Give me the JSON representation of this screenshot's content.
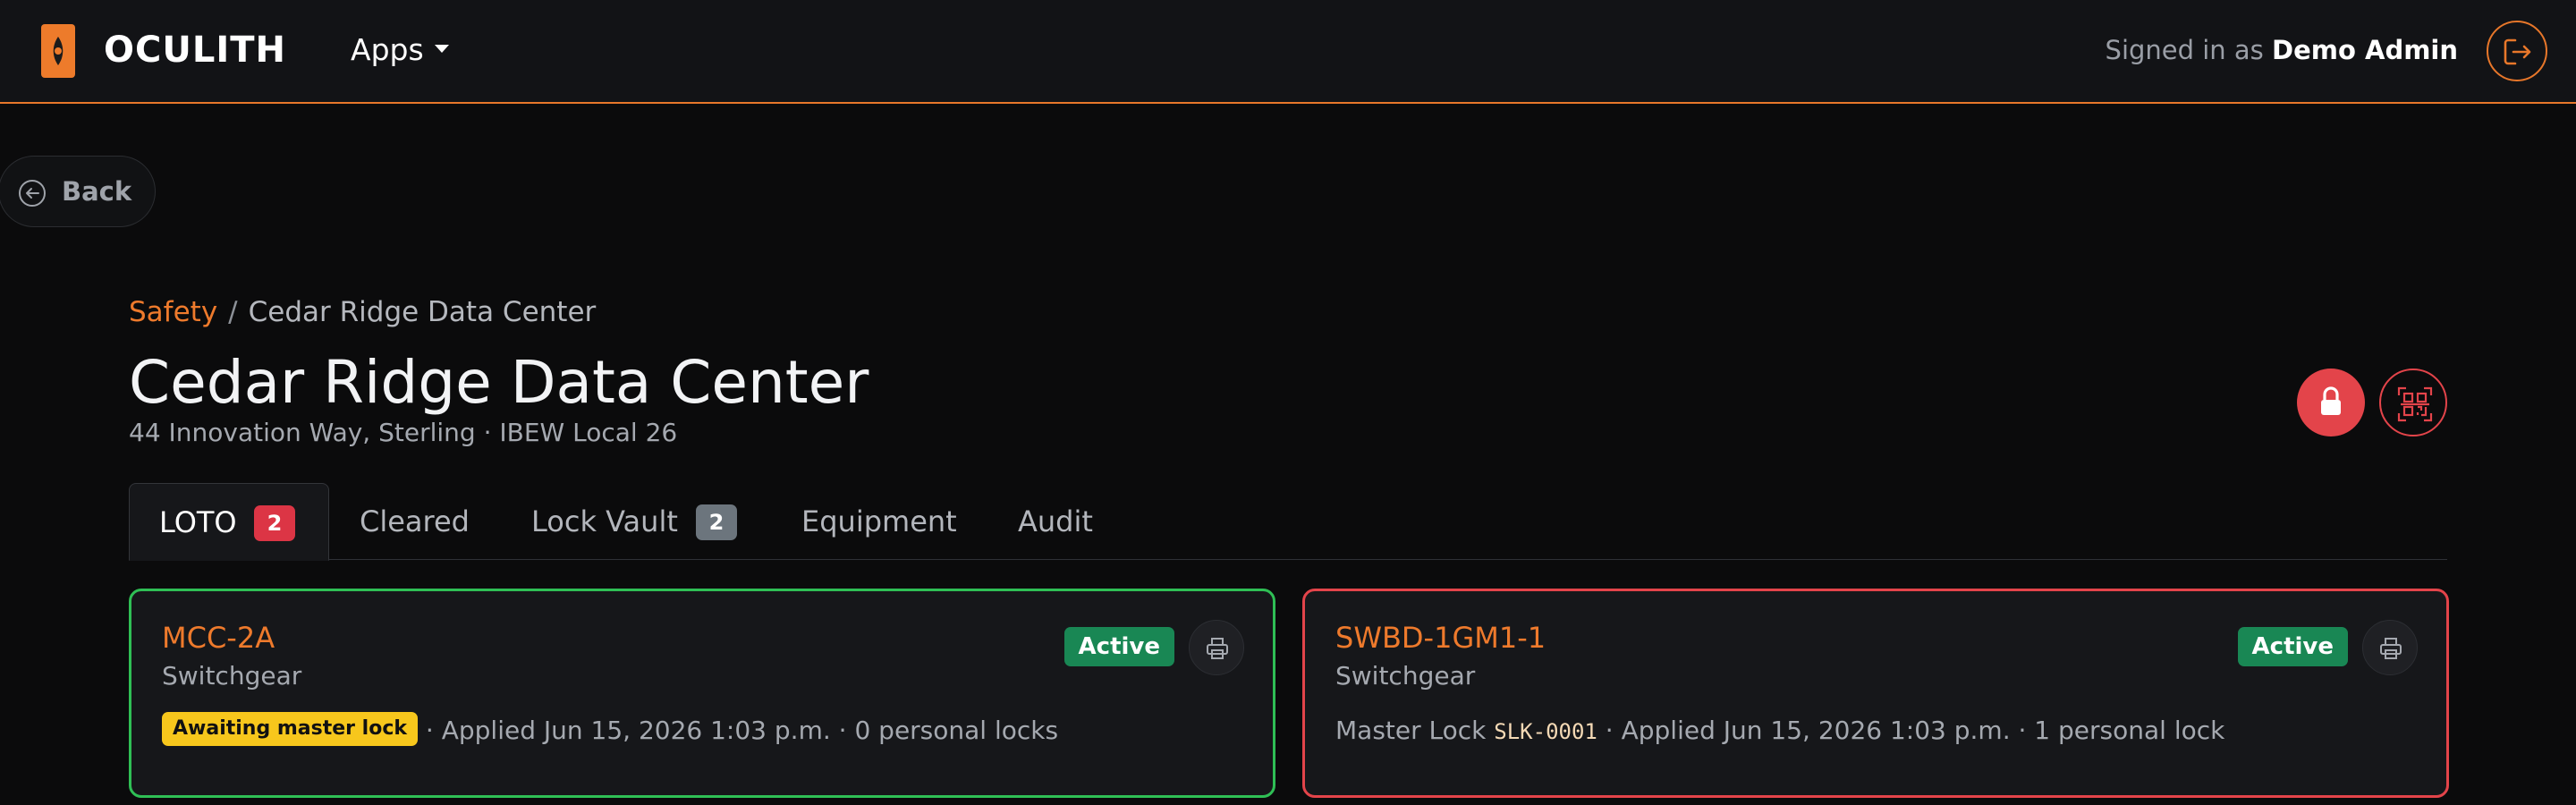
{
  "navbar": {
    "brand": "OCULITH",
    "apps_label": "Apps",
    "signed_prefix": "Signed in as",
    "user_name": "Demo Admin",
    "accent_color": "#e8772a"
  },
  "back": {
    "label": "Back"
  },
  "breadcrumb": {
    "root": "Safety",
    "separator": "/",
    "current": "Cedar Ridge Data Center"
  },
  "page": {
    "title": "Cedar Ridge Data Center",
    "subtitle": "44 Innovation Way, Sterling · IBEW Local 26"
  },
  "tabs": [
    {
      "label": "LOTO",
      "badge": "2",
      "badge_color": "#dc3545",
      "active": true
    },
    {
      "label": "Cleared"
    },
    {
      "label": "Lock Vault",
      "badge": "2",
      "badge_color": "#6c757d"
    },
    {
      "label": "Equipment"
    },
    {
      "label": "Audit"
    }
  ],
  "cards": [
    {
      "name": "MCC-2A",
      "type": "Switchgear",
      "status": "Active",
      "border_color": "#2fbf55",
      "warning_badge": "Awaiting master lock",
      "meta": "· Applied Jun 15, 2026 1:03 p.m. · 0 personal locks"
    },
    {
      "name": "SWBD-1GM1-1",
      "type": "Switchgear",
      "status": "Active",
      "border_color": "#e3444a",
      "lock_prefix": "Master Lock",
      "lock_code": "SLK-0001",
      "meta": "· Applied Jun 15, 2026 1:03 p.m. · 1 personal lock"
    }
  ]
}
